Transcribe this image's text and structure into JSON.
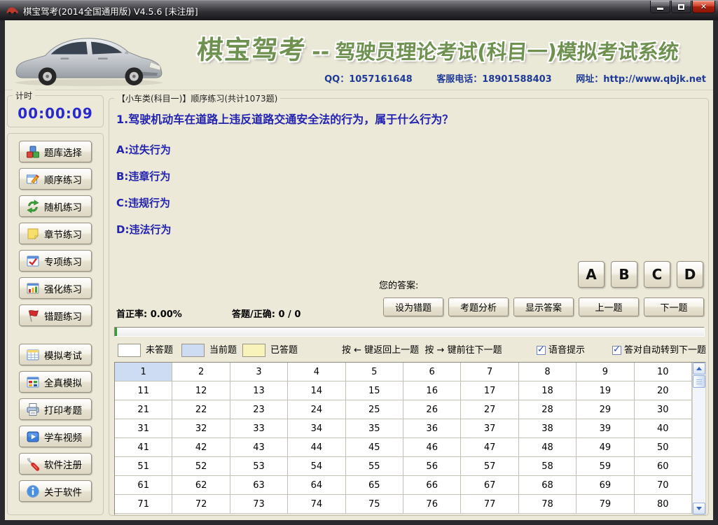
{
  "window": {
    "title": "棋宝驾考(2014全国通用版) V4.5.6 [未注册]"
  },
  "header": {
    "brand": "棋宝驾考",
    "separator": "--",
    "system_title": "驾驶员理论考试(科目一)模拟考试系统",
    "qq": "QQ：1057161648",
    "phone": "客服电话：18901588403",
    "website": "网址：http://www.qbjk.net"
  },
  "sidebar": {
    "timer": {
      "label": "计时",
      "value": "00:00:09"
    },
    "buttons": [
      {
        "label": "题库选择",
        "icon": "cubes-icon"
      },
      {
        "label": "顺序练习",
        "icon": "pencil-icon"
      },
      {
        "label": "随机练习",
        "icon": "shuffle-arrows-icon"
      },
      {
        "label": "章节练习",
        "icon": "note-icon"
      },
      {
        "label": "专项练习",
        "icon": "red-check-icon"
      },
      {
        "label": "强化练习",
        "icon": "bar-chart-icon"
      },
      {
        "label": "错题练习",
        "icon": "red-flag-icon"
      },
      {
        "label": "模拟考试",
        "icon": "exam-table-icon"
      },
      {
        "label": "全真模拟",
        "icon": "color-grid-icon"
      },
      {
        "label": "打印考题",
        "icon": "printer-icon"
      },
      {
        "label": "学车视频",
        "icon": "video-play-icon"
      },
      {
        "label": "软件注册",
        "icon": "screwdriver-icon"
      },
      {
        "label": "关于软件",
        "icon": "info-icon"
      }
    ]
  },
  "main": {
    "group_title": "【小车类(科目一)】顺序练习(共计1073题)",
    "question": "1.驾驶机动车在道路上违反道路交通安全法的行为，属于什么行为？",
    "options": [
      "A:过失行为",
      "B:违章行为",
      "C:违规行为",
      "D:违法行为"
    ],
    "answer_label": "您的答案:",
    "answer_choices": [
      "A",
      "B",
      "C",
      "D"
    ],
    "first_rate": "首正率: 0.00%",
    "answered": "答题/正确: 0 / 0",
    "actions": [
      "设为错题",
      "考题分析",
      "显示答案",
      "上一题",
      "下一题"
    ],
    "progress_percent": 0.4,
    "legend": [
      {
        "label": "未答题",
        "color": "#ffffff"
      },
      {
        "label": "当前题",
        "color": "#cddcf3"
      },
      {
        "label": "已答题",
        "color": "#f7f3bb"
      }
    ],
    "key_hints": "按 ← 键返回上一题  按 → 键前往下一题",
    "checkboxes": [
      {
        "label": "语音提示",
        "checked": true
      },
      {
        "label": "答对自动转到下一题",
        "checked": true
      }
    ],
    "grid": {
      "columns": 10,
      "current": 1,
      "cells": [
        1,
        2,
        3,
        4,
        5,
        6,
        7,
        8,
        9,
        10,
        11,
        12,
        13,
        14,
        15,
        16,
        17,
        18,
        19,
        20,
        21,
        22,
        23,
        24,
        25,
        26,
        27,
        28,
        29,
        30,
        31,
        32,
        33,
        34,
        35,
        36,
        37,
        38,
        39,
        40,
        41,
        42,
        43,
        44,
        45,
        46,
        47,
        48,
        49,
        50,
        51,
        52,
        53,
        54,
        55,
        56,
        57,
        58,
        59,
        60,
        61,
        62,
        63,
        64,
        65,
        66,
        67,
        68,
        69,
        70,
        71,
        72,
        73,
        74,
        75,
        76,
        77,
        78,
        79,
        80
      ]
    }
  },
  "colors": {
    "brand_green": "#6f9150",
    "contact_navy": "#1e3a96",
    "question_blue": "#2323b0",
    "timer_blue": "#2a2acc",
    "current_cell_blue": "#cddcf3",
    "answered_cell_yellow": "#f7f3bb",
    "progress_green": "#33a033"
  }
}
